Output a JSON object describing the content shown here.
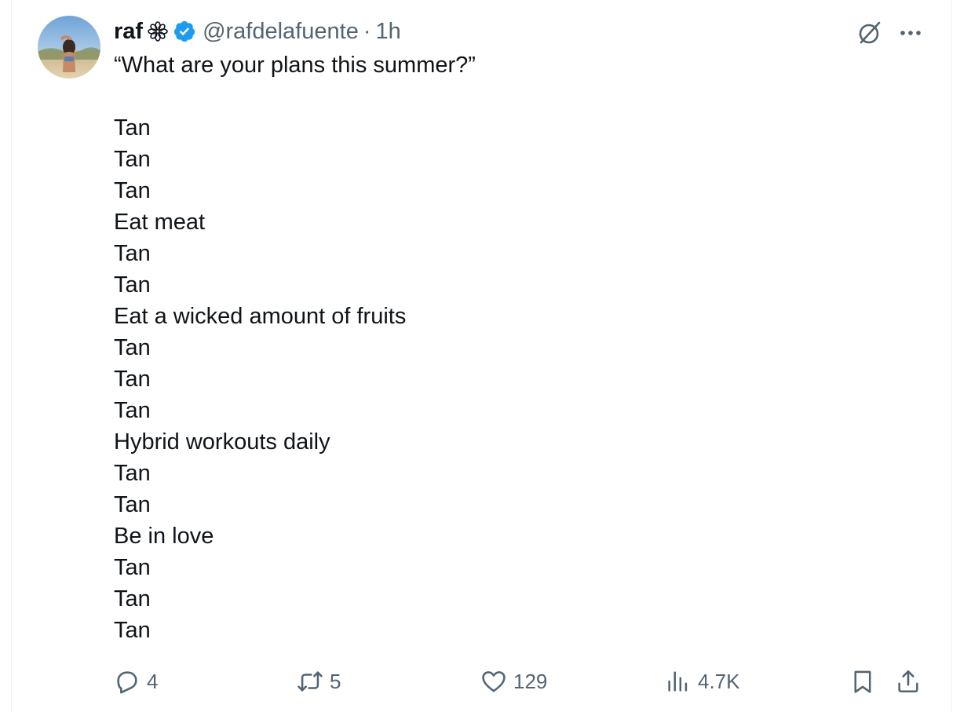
{
  "author": {
    "name": "raf",
    "handle": "@rafdelafuente",
    "separator": "·",
    "time": "1h",
    "avatar_icon": "profile-photo",
    "badge_icon": "verified-badge-icon",
    "badge_color": "#1d9bf0"
  },
  "tweet": {
    "lines": [
      "“What are your plans this summer?”",
      "",
      "Tan",
      "Tan",
      "Tan",
      "Eat meat",
      "Tan",
      "Tan",
      "Eat a wicked amount of fruits",
      "Tan",
      "Tan",
      "Tan",
      "Hybrid workouts daily",
      "Tan",
      "Tan",
      "Be in love",
      "Tan",
      "Tan",
      "Tan"
    ]
  },
  "actions": {
    "reply_count": "4",
    "retweet_count": "5",
    "like_count": "129",
    "views_count": "4.7K"
  },
  "colors": {
    "text": "#0f1419",
    "secondary": "#536471",
    "accent": "#1d9bf0"
  }
}
